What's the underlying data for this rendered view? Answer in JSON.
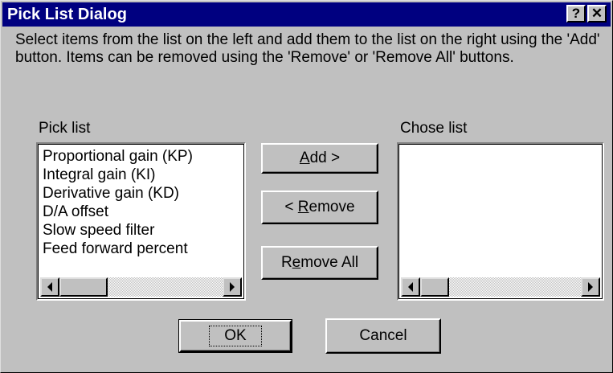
{
  "window": {
    "title": "Pick List Dialog",
    "help_label": "?",
    "close_label": "✕"
  },
  "instructions": "Select items from the list on the left and add them to the list on the right using the 'Add' button.  Items can be removed using the 'Remove' or 'Remove All' buttons.",
  "pick_list": {
    "label": "Pick list",
    "items": [
      "Proportional gain (KP)",
      "Integral gain (KI)",
      "Derivative gain (KD)",
      "D/A offset",
      "Slow speed filter",
      "Feed forward percent"
    ]
  },
  "chose_list": {
    "label": "Chose list",
    "items": []
  },
  "buttons": {
    "add": {
      "mnemonic": "A",
      "rest": "dd >"
    },
    "remove": {
      "prefix": "< ",
      "mnemonic": "R",
      "rest": "emove"
    },
    "remove_all": {
      "prefix": "R",
      "mnemonic": "e",
      "rest": "move All"
    },
    "ok": "OK",
    "cancel": "Cancel"
  },
  "icons": {
    "scroll_left": "arrow-left-icon",
    "scroll_right": "arrow-right-icon"
  }
}
